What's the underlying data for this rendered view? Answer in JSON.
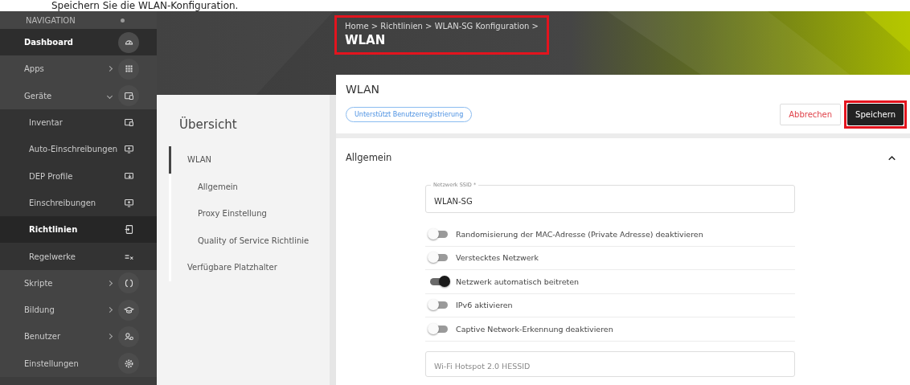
{
  "caption": "Speichern Sie die WLAN-Konfiguration.",
  "sidebar": {
    "heading": "NAVIGATION",
    "items": [
      {
        "label": "Dashboard",
        "kind": "link",
        "selected": true
      },
      {
        "label": "Apps",
        "kind": "group",
        "selected": false,
        "expanded": false
      },
      {
        "label": "Geräte",
        "kind": "group",
        "selected": false,
        "expanded": true,
        "children": [
          {
            "label": "Inventar",
            "kind": "sub",
            "selected": false
          },
          {
            "label": "Auto-Einschreibungen",
            "kind": "sub",
            "selected": false
          },
          {
            "label": "DEP Profile",
            "kind": "sub",
            "selected": false
          },
          {
            "label": "Einschreibungen",
            "kind": "sub",
            "selected": false
          },
          {
            "label": "Richtlinien",
            "kind": "sub",
            "selected": true
          },
          {
            "label": "Regelwerke",
            "kind": "sub",
            "selected": false
          }
        ]
      },
      {
        "label": "Skripte",
        "kind": "group",
        "selected": false,
        "expanded": false
      },
      {
        "label": "Bildung",
        "kind": "group",
        "selected": false,
        "expanded": false
      },
      {
        "label": "Benutzer",
        "kind": "group",
        "selected": false,
        "expanded": false
      },
      {
        "label": "Einstellungen",
        "kind": "link",
        "selected": false
      }
    ]
  },
  "header": {
    "breadcrumb": "Home > Richtlinien > WLAN-SG Konfiguration >",
    "title": "WLAN",
    "highlight": true
  },
  "overview": {
    "title": "Übersicht",
    "items": [
      {
        "label": "WLAN",
        "selected": true,
        "children": [
          {
            "label": "Allgemein",
            "selected": false
          },
          {
            "label": "Proxy Einstellung",
            "selected": false
          },
          {
            "label": "Quality of Service Richtlinie",
            "selected": false
          }
        ]
      },
      {
        "label": "Verfügbare Platzhalter",
        "selected": false
      }
    ]
  },
  "main": {
    "title": "WLAN",
    "badge": "Unterstützt Benutzerregistrierung",
    "buttons": [
      {
        "label": "Abbrechen",
        "kind": "secondary",
        "highlight": false
      },
      {
        "label": "Speichern",
        "kind": "primary",
        "highlight": true
      }
    ],
    "section": {
      "title": "Allgemein",
      "expanded": true,
      "ssid_field": {
        "label": "Netzwerk SSID *",
        "value": "WLAN-SG"
      },
      "toggles": [
        {
          "label": "Randomisierung der MAC-Adresse (Private Adresse) deaktivieren",
          "on": false
        },
        {
          "label": "Verstecktes Netzwerk",
          "on": false
        },
        {
          "label": "Netzwerk automatisch beitreten",
          "on": true
        },
        {
          "label": "IPv6 aktivieren",
          "on": false
        },
        {
          "label": "Captive Network-Erkennung deaktivieren",
          "on": false
        }
      ],
      "hessid_field": {
        "placeholder": "Wi-Fi Hotspot 2.0 HESSID"
      }
    }
  }
}
